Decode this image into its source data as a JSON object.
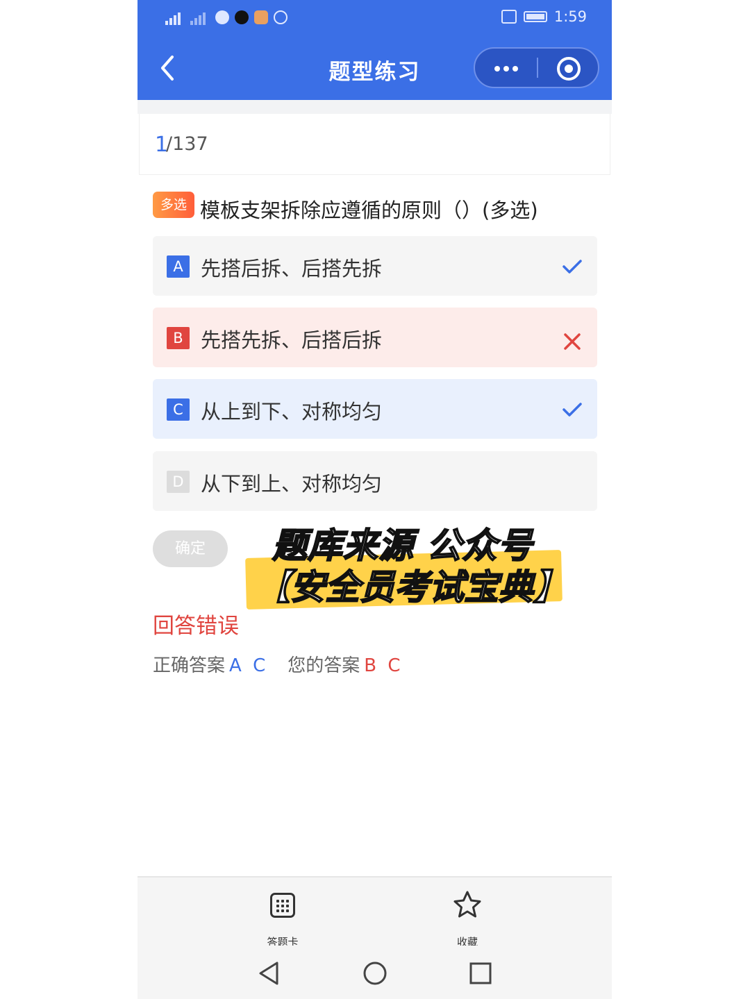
{
  "status_bar": {
    "time": "1:59",
    "network": "4G"
  },
  "navbar": {
    "title": "题型练习",
    "back_icon": "chevron-left-icon",
    "more_icon": "more-dots-icon",
    "close_icon": "target-close-icon"
  },
  "progress": {
    "current": "1",
    "total": "/137"
  },
  "question": {
    "type_tag": "多选",
    "text": "模板支架拆除应遵循的原则（）(多选)",
    "options": [
      {
        "letter": "A",
        "text": "先搭后拆、后搭先拆",
        "state": "correct",
        "mark": "check"
      },
      {
        "letter": "B",
        "text": "先搭先拆、后搭后拆",
        "state": "wrong",
        "mark": "cross"
      },
      {
        "letter": "C",
        "text": "从上到下、对称均匀",
        "state": "correct-selected",
        "mark": "check"
      },
      {
        "letter": "D",
        "text": "从下到上、对称均匀",
        "state": "neutral",
        "mark": ""
      }
    ]
  },
  "confirm_label": "确定",
  "overlay": {
    "line1": "题库来源 公众号",
    "line2": "【安全员考试宝典】"
  },
  "result": {
    "status": "回答错误",
    "correct_label": "正确答案",
    "correct_value": "A C",
    "yours_label": "您的答案",
    "yours_value": "B C"
  },
  "bottom_tabs": [
    {
      "label": "答题卡",
      "icon": "answer-card-icon"
    },
    {
      "label": "收藏",
      "icon": "star-icon"
    }
  ],
  "colors": {
    "primary": "#3b6fe6",
    "error": "#e0453f",
    "tag": "#ff7a3d"
  }
}
